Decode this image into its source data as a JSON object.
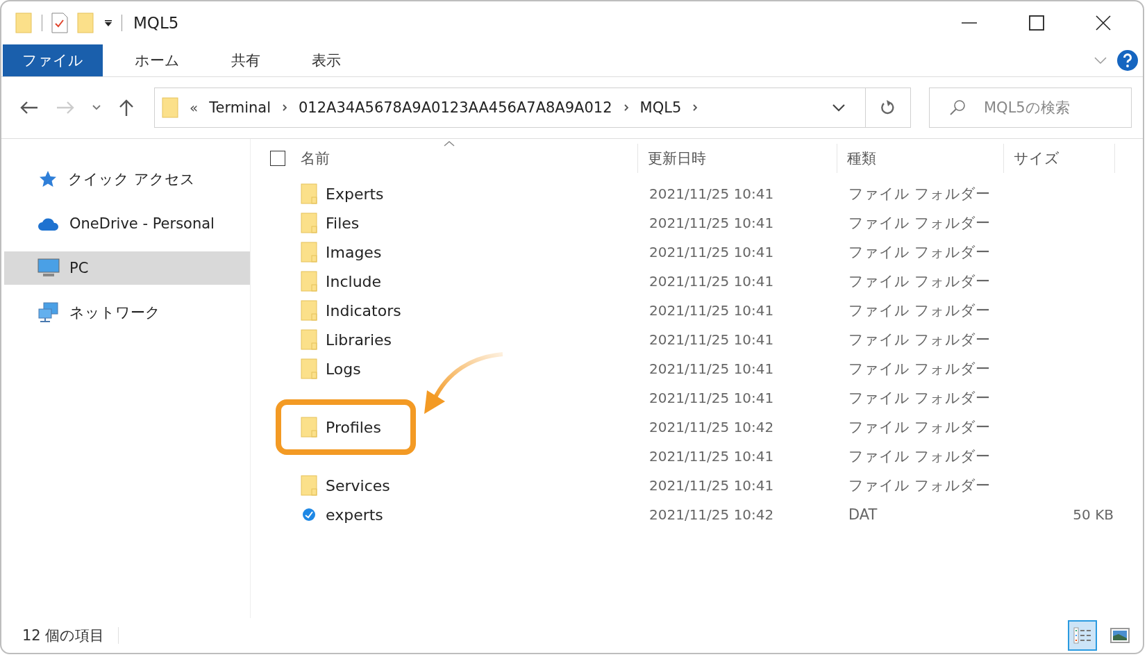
{
  "window": {
    "title": "MQL5"
  },
  "ribbon_tabs": [
    {
      "label": "ファイル",
      "selected": true
    },
    {
      "label": "ホーム",
      "selected": false
    },
    {
      "label": "共有",
      "selected": false
    },
    {
      "label": "表示",
      "selected": false
    }
  ],
  "address": {
    "overflow": "«",
    "crumbs": [
      "Terminal",
      "012A34A5678A9A0123AA456A7A8A9A012",
      "MQL5"
    ]
  },
  "search": {
    "placeholder": "MQL5の検索"
  },
  "sidebar": {
    "items": [
      {
        "label": "クイック アクセス",
        "kind": "quick_access",
        "selected": false
      },
      {
        "label": "OneDrive - Personal",
        "kind": "cloud",
        "selected": false
      },
      {
        "label": "PC",
        "kind": "computer",
        "selected": true
      },
      {
        "label": "ネットワーク",
        "kind": "network",
        "selected": false
      }
    ]
  },
  "table": {
    "select_all": {
      "checked": false
    },
    "columns": [
      "名前",
      "更新日時",
      "種類",
      "サイズ"
    ],
    "rows": [
      {
        "kind": "folder",
        "name": "Experts",
        "modified": "2021/11/25 10:41",
        "type": "ファイル フォルダー",
        "highlighted": false
      },
      {
        "kind": "folder",
        "name": "Files",
        "modified": "2021/11/25 10:41",
        "type": "ファイル フォルダー",
        "highlighted": false
      },
      {
        "kind": "folder",
        "name": "Images",
        "modified": "2021/11/25 10:41",
        "type": "ファイル フォルダー",
        "highlighted": false
      },
      {
        "kind": "folder",
        "name": "Include",
        "modified": "2021/11/25 10:41",
        "type": "ファイル フォルダー",
        "highlighted": false
      },
      {
        "kind": "folder",
        "name": "Indicators",
        "modified": "2021/11/25 10:41",
        "type": "ファイル フォルダー",
        "highlighted": false
      },
      {
        "kind": "folder",
        "name": "Libraries",
        "modified": "2021/11/25 10:41",
        "type": "ファイル フォルダー",
        "highlighted": false
      },
      {
        "kind": "folder",
        "name": "Logs",
        "modified": "2021/11/25 10:41",
        "type": "ファイル フォルダー",
        "highlighted": false
      },
      {
        "kind": "folder",
        "modified": "2021/11/25 10:41",
        "type": "ファイル フォルダー",
        "highlighted": false
      },
      {
        "kind": "folder",
        "name": "Profiles",
        "modified": "2021/11/25 10:42",
        "type": "ファイル フォルダー",
        "highlighted": true
      },
      {
        "kind": "folder",
        "modified": "2021/11/25 10:41",
        "type": "ファイル フォルダー",
        "highlighted": false
      },
      {
        "kind": "folder",
        "name": "Services",
        "modified": "2021/11/25 10:41",
        "type": "ファイル フォルダー",
        "highlighted": false
      },
      {
        "kind": "file",
        "name": "experts",
        "modified": "2021/11/25 10:42",
        "type": "DAT",
        "size": "50 KB",
        "highlighted": false
      }
    ]
  },
  "status_bar": {
    "count": "12 個の項目"
  },
  "view_buttons": [
    {
      "kind": "details",
      "selected": true
    },
    {
      "kind": "tiles",
      "selected": false
    }
  ]
}
